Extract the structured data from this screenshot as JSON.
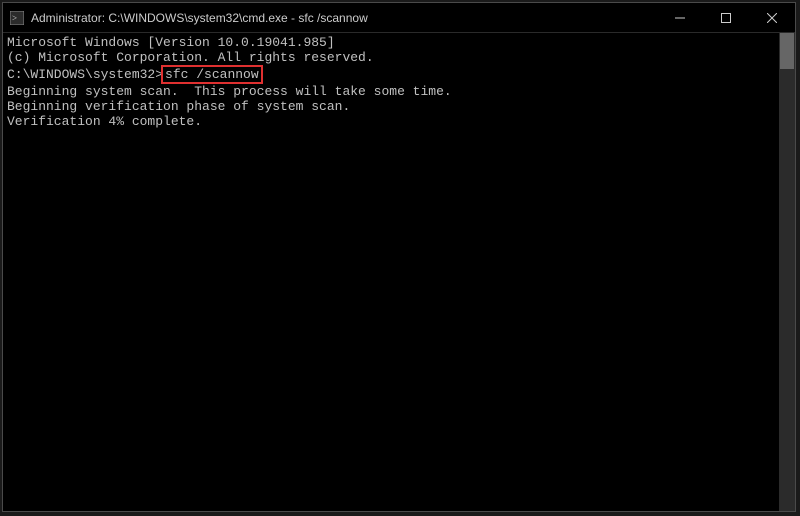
{
  "titlebar": {
    "title": "Administrator: C:\\WINDOWS\\system32\\cmd.exe - sfc  /scannow"
  },
  "terminal": {
    "line1": "Microsoft Windows [Version 10.0.19041.985]",
    "line2": "(c) Microsoft Corporation. All rights reserved.",
    "blank1": "",
    "prompt": "C:\\WINDOWS\\system32>",
    "command": "sfc /scannow",
    "blank2": "",
    "line3": "Beginning system scan.  This process will take some time.",
    "blank3": "",
    "line4": "Beginning verification phase of system scan.",
    "line5": "Verification 4% complete."
  },
  "window_controls": {
    "minimize": "─",
    "maximize": "☐",
    "close": "✕"
  }
}
